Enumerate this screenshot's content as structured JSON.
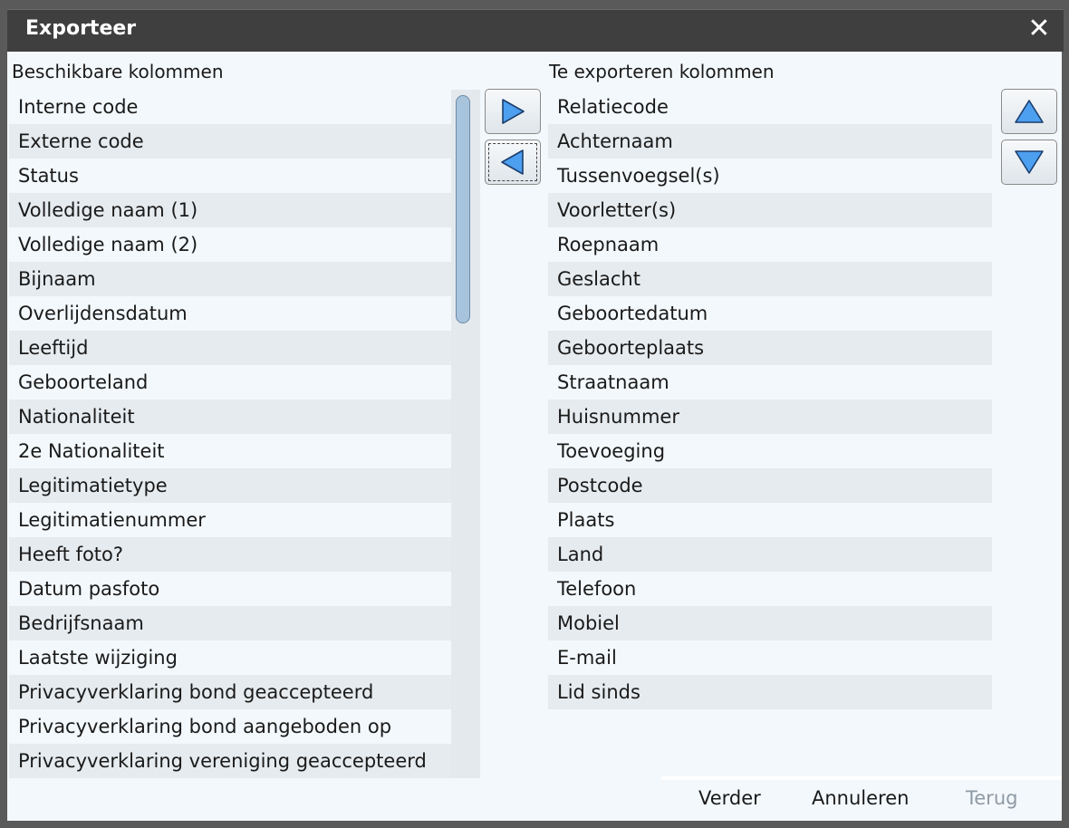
{
  "window": {
    "title": "Exporteer",
    "close_glyph": "✕"
  },
  "available": {
    "heading": "Beschikbare kolommen",
    "items": [
      "Interne code",
      "Externe code",
      "Status",
      "Volledige naam (1)",
      "Volledige naam (2)",
      "Bijnaam",
      "Overlijdensdatum",
      "Leeftijd",
      "Geboorteland",
      "Nationaliteit",
      "2e Nationaliteit",
      "Legitimatietype",
      "Legitimatienummer",
      "Heeft foto?",
      "Datum pasfoto",
      "Bedrijfsnaam",
      "Laatste wijziging",
      "Privacyverklaring bond geaccepteerd",
      "Privacyverklaring bond aangeboden op",
      "Privacyverklaring vereniging geaccepteerd"
    ]
  },
  "selected": {
    "heading": "Te exporteren kolommen",
    "items": [
      "Relatiecode",
      "Achternaam",
      "Tussenvoegsel(s)",
      "Voorletter(s)",
      "Roepnaam",
      "Geslacht",
      "Geboortedatum",
      "Geboorteplaats",
      "Straatnaam",
      "Huisnummer",
      "Toevoeging",
      "Postcode",
      "Plaats",
      "Land",
      "Telefoon",
      "Mobiel",
      "E-mail",
      "Lid sinds"
    ]
  },
  "transfer_buttons": {
    "add_icon": "triangle-right-icon",
    "remove_icon": "triangle-left-icon"
  },
  "order_buttons": {
    "up_icon": "triangle-up-icon",
    "down_icon": "triangle-down-icon"
  },
  "footer": {
    "next_label": "Verder",
    "cancel_label": "Annuleren",
    "back_label": "Terug"
  },
  "colors": {
    "arrow_fill": "#4d9ff0",
    "arrow_stroke": "#1b3f6e"
  }
}
